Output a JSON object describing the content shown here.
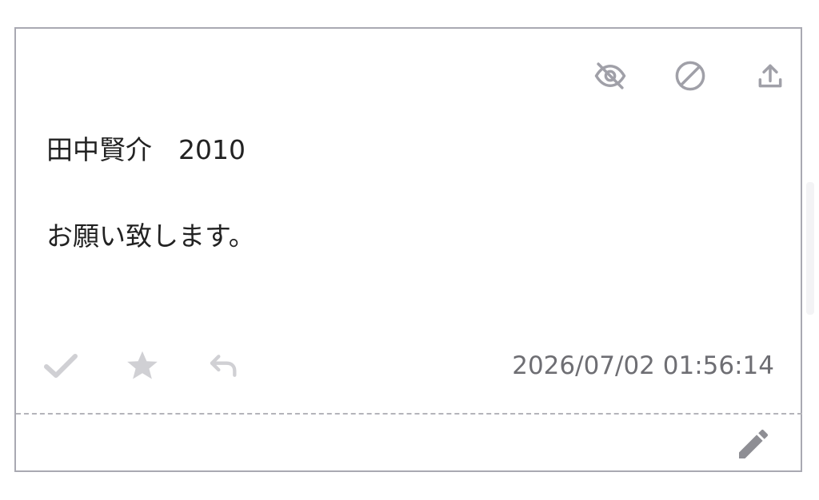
{
  "post": {
    "author_line": "田中賢介　2010",
    "message": "お願い致します。",
    "timestamp": "2026/07/02 01:56:14"
  },
  "top_icons": [
    "eye-off-icon",
    "block-icon",
    "upload-icon"
  ],
  "bottom_icons": [
    "check-icon",
    "star-icon",
    "reply-icon"
  ],
  "colors": {
    "border": "#a9a9b2",
    "icon_top": "#a0a0a8",
    "icon_bottom": "#d0d0d4",
    "text": "#222222",
    "timestamp": "#6e6e73",
    "edit_icon": "#8e8e94"
  }
}
